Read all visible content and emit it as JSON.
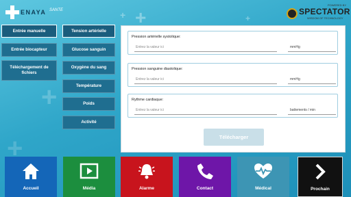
{
  "header": {
    "brand_name": "ENAYA",
    "brand_sub": "SANTE",
    "partner_powered": "POWERED BY",
    "partner_name": "SPECTATOR",
    "partner_tagline": "WISDOM OF TECHNOLOGY"
  },
  "sidebar": {
    "input_modes": [
      {
        "label": "Entrée manuelle",
        "active": true
      },
      {
        "label": "Entrée biocapteur",
        "active": false
      },
      {
        "label": "Téléchargement de fichiers",
        "active": false
      }
    ],
    "measures": [
      {
        "label": "Tension artérielle",
        "active": true
      },
      {
        "label": "Glucose sanguin",
        "active": false
      },
      {
        "label": "Oxygène du sang",
        "active": false
      },
      {
        "label": "Température",
        "active": false
      },
      {
        "label": "Poids",
        "active": false
      },
      {
        "label": "Activité",
        "active": false
      }
    ]
  },
  "form": {
    "fields": [
      {
        "label": "Pression artérielle systolique:",
        "placeholder": "Entrez la valeur ici",
        "unit": "mmHg"
      },
      {
        "label": "Pression sanguine diastolique:",
        "placeholder": "Entrez la valeur ici",
        "unit": "mmHg"
      },
      {
        "label": "Rythme cardiaque:",
        "placeholder": "Entrez la valeur ici",
        "unit": "battements / min"
      }
    ],
    "submit_label": "Télécharger"
  },
  "bottom_nav": [
    {
      "label": "Accueil",
      "icon": "home-icon",
      "color": "#1466b8"
    },
    {
      "label": "Média",
      "icon": "media-play-icon",
      "color": "#1c8e3e"
    },
    {
      "label": "Alarme",
      "icon": "bell-icon",
      "color": "#c8141d"
    },
    {
      "label": "Contact",
      "icon": "phone-icon",
      "color": "#6e16a8"
    },
    {
      "label": "Médical",
      "icon": "heart-pulse-icon",
      "color": "#3d95b4"
    },
    {
      "label": "Prochain",
      "icon": "chevron-right-icon",
      "color": "#111111"
    }
  ]
}
